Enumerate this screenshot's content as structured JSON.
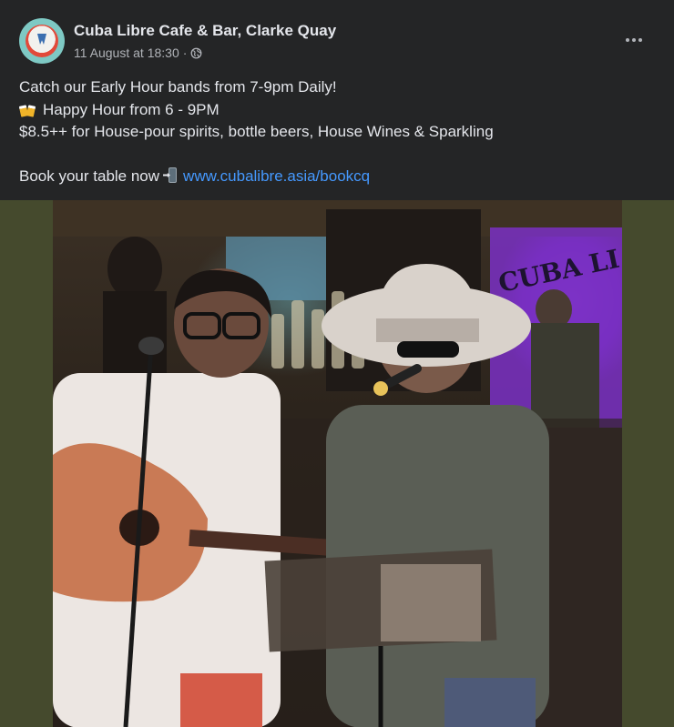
{
  "post": {
    "page_name": "Cuba Libre Cafe & Bar, Clarke Quay",
    "timestamp": "11 August at 18:30",
    "separator": "·",
    "privacy_icon": "globe-icon",
    "more_icon": "more-options-icon",
    "text": {
      "line1": "Catch our Early Hour bands from 7-9pm Daily!",
      "line2": "Happy Hour from 6 - 9PM",
      "line3": "$8.5++ for House-pour spirits, bottle beers, House Wines & Sparkling",
      "line4_prefix": "Book your table now",
      "link": "www.cubalibre.asia/bookcq"
    },
    "emojis": [
      "beer-mugs-emoji",
      "phone-arrow-emoji"
    ]
  },
  "photo": {
    "sign_text": "CUBA LI",
    "colors": {
      "frame": "#454a2d",
      "neon": "#8a3fd0",
      "hat": "#d9d2cb",
      "shirt_left": "#ece6e2",
      "shirt_right": "#5a5e55",
      "guitar": "#c97a55"
    }
  }
}
